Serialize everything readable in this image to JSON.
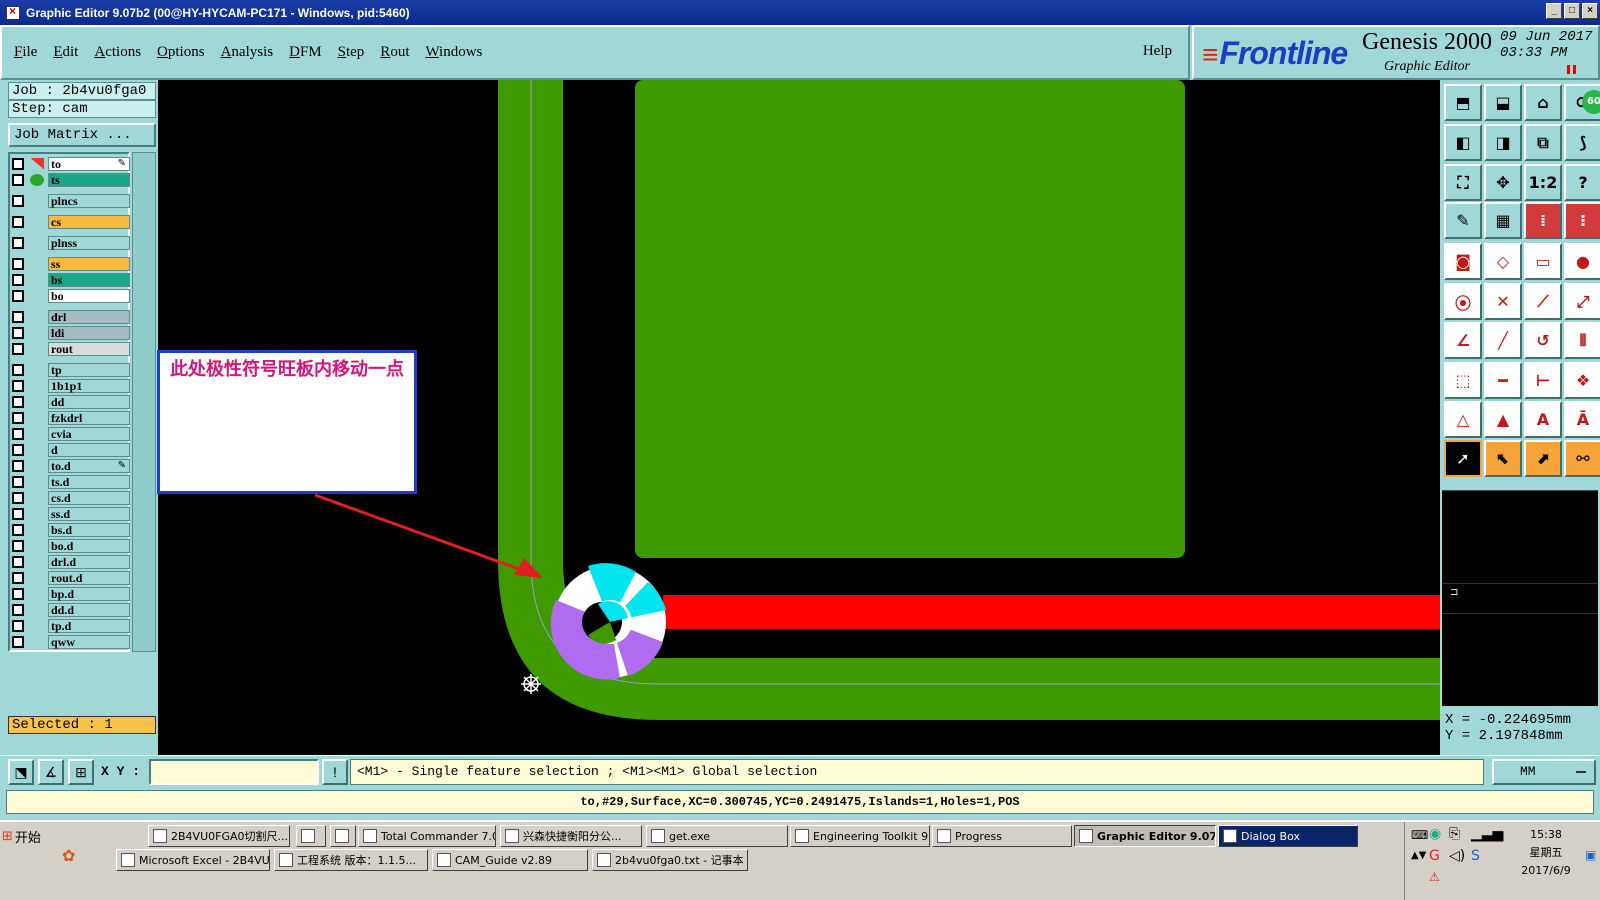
{
  "window": {
    "title": "Graphic Editor 9.07b2 (00@HY-HYCAM-PC171 - Windows, pid:5460)",
    "controls": [
      "_",
      "□",
      "×"
    ]
  },
  "menu": {
    "items": [
      "File",
      "Edit",
      "Actions",
      "Options",
      "Analysis",
      "DFM",
      "Step",
      "Rout",
      "Windows"
    ],
    "help": "Help"
  },
  "brand": {
    "logo": "Frontline",
    "product": "Genesis 2000",
    "subtitle": "Graphic Editor",
    "date_line1": "09 Jun 2017",
    "date_line2": "03:33 PM"
  },
  "job": {
    "job_label": "Job : 2b4vu0fga0",
    "step_label": "Step: cam",
    "matrix_button": "Job Matrix ..."
  },
  "layers": [
    {
      "name": "to",
      "color": "#ffffff",
      "mark": "red",
      "edit": true
    },
    {
      "name": "ts",
      "color": "#1aa588",
      "mark": "green"
    },
    {
      "name": "plncs",
      "color": "#9fd8d6"
    },
    {
      "name": "cs",
      "color": "#f9b840"
    },
    {
      "name": "plnss",
      "color": "#9fd8d6"
    },
    {
      "name": "ss",
      "color": "#f9b840"
    },
    {
      "name": "bs",
      "color": "#1aa588"
    },
    {
      "name": "bo",
      "color": "#ffffff"
    },
    {
      "name": "drl",
      "color": "#a7bcc2"
    },
    {
      "name": "ldi",
      "color": "#a7bcc2"
    },
    {
      "name": "rout",
      "color": "#d8dcdc"
    },
    {
      "name": "tp",
      "color": "#9fd8d6"
    },
    {
      "name": "1b1p1",
      "color": "#9fd8d6"
    },
    {
      "name": "dd",
      "color": "#9fd8d6"
    },
    {
      "name": "fzkdrl",
      "color": "#9fd8d6"
    },
    {
      "name": "cvia",
      "color": "#9fd8d6"
    },
    {
      "name": "d",
      "color": "#9fd8d6"
    },
    {
      "name": "to.d",
      "color": "#9fd8d6",
      "edit": true
    },
    {
      "name": "ts.d",
      "color": "#9fd8d6"
    },
    {
      "name": "cs.d",
      "color": "#9fd8d6"
    },
    {
      "name": "ss.d",
      "color": "#9fd8d6"
    },
    {
      "name": "bs.d",
      "color": "#9fd8d6"
    },
    {
      "name": "bo.d",
      "color": "#9fd8d6"
    },
    {
      "name": "drl.d",
      "color": "#9fd8d6"
    },
    {
      "name": "rout.d",
      "color": "#9fd8d6"
    },
    {
      "name": "bp.d",
      "color": "#9fd8d6"
    },
    {
      "name": "dd.d",
      "color": "#9fd8d6"
    },
    {
      "name": "tp.d",
      "color": "#9fd8d6"
    },
    {
      "name": "qww",
      "color": "#9fd8d6"
    }
  ],
  "selected": "Selected : 1",
  "annotation": {
    "text": "此处极性符号旺板内移动一点",
    "color": "#d6157c",
    "border_color": "#1c3ecf"
  },
  "canvas_colors": {
    "background": "#000000",
    "copper": "#3f9a00",
    "trace": "#ff0000",
    "symbol_cyan": "#00e5ee",
    "symbol_purple": "#b06bf0",
    "arrow": "#e02020"
  },
  "toolbar": {
    "rows": [
      [
        "zoom-home-icon",
        "zoom-in-icon",
        "home-icon",
        "redisplay-icon"
      ],
      [
        "pan-left-icon",
        "pan-right-icon",
        "mirror-icon",
        "snap-icon"
      ],
      [
        "fit-icon",
        "center-icon",
        "scale-icon",
        "query-icon"
      ],
      [
        "measure-icon",
        "grid-icon",
        "layer-select-icon",
        "layer-compare-icon"
      ],
      [
        "pad-add-icon",
        "shape-icon",
        "ruler-icon",
        "dot-icon"
      ],
      [
        "connect-icon",
        "delete-node-icon",
        "line-icon",
        "line-add-icon"
      ],
      [
        "angle-icon",
        "slash-icon",
        "arc-icon",
        "align-icon"
      ],
      [
        "move-icon",
        "horizontal-icon",
        "dimension-icon",
        "group-icon"
      ],
      [
        "triangle-icon",
        "triangle-up-icon",
        "text-a-icon",
        "text-b-icon"
      ],
      [
        "select-icon",
        "select-frame-icon",
        "select-box-icon",
        "select-net-icon"
      ]
    ],
    "badge": "60"
  },
  "coords": {
    "x": "X = -0.224695mm",
    "y": "Y = 2.197848mm"
  },
  "command": {
    "xy_label": "X Y :",
    "xy_value": "",
    "hint": "<M1> - Single feature selection ; <M1><M1> Global selection",
    "units": "MM",
    "bang": "!"
  },
  "status": "to,#29,Surface,XC=0.300745,YC=0.2491475,Islands=1,Holes=1,POS",
  "taskbar": {
    "start": "开始",
    "row1": [
      {
        "label": "2B4VU0FGA0切割尺..."
      },
      {
        "label": ""
      },
      {
        "label": ""
      },
      {
        "label": "Total Commander 7.0..."
      },
      {
        "label": "兴森快捷衡阳分公..."
      },
      {
        "label": "get.exe"
      },
      {
        "label": "Engineering Toolkit 9...."
      },
      {
        "label": "Progress"
      },
      {
        "label": "Graphic Editor 9.07..."
      },
      {
        "label": "Dialog Box"
      }
    ],
    "row2": [
      {
        "label": "Microsoft Excel - 2B4VU0..."
      },
      {
        "label": "工程系统  版本：1.1.5..."
      },
      {
        "label": "CAM_Guide v2.89"
      },
      {
        "label": "2b4vu0fga0.txt - 记事本"
      }
    ],
    "clock": {
      "time": "15:38",
      "weekday": "星期五",
      "date": "2017/6/9"
    }
  }
}
